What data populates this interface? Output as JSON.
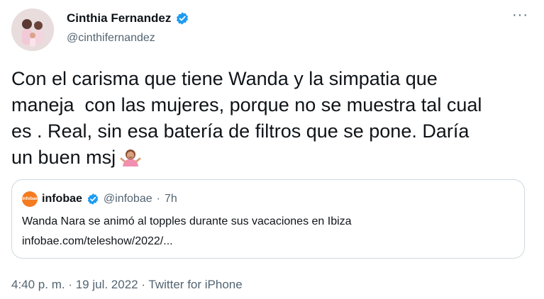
{
  "author": {
    "name": "Cinthia Fernandez",
    "handle": "@cinthifernandez"
  },
  "menu": {
    "more_label": "···"
  },
  "tweet": {
    "text": "Con el carisma que tiene Wanda y la simpatia que\nmaneja  con las mujeres, porque no se muestra tal cual\nes . Real, sin esa batería de filtros que se pone. Daría\nun buen msj"
  },
  "quote": {
    "logo_text": "infobae",
    "name": "infobae",
    "handle": "@infobae",
    "separator": "·",
    "time": "7h",
    "text": "Wanda Nara se animó al topples durante sus vacaciones en Ibiza",
    "link": "infobae.com/teleshow/2022/..."
  },
  "meta": {
    "timestamp": "4:40 p. m. · 19 jul. 2022 · Twitter for iPhone"
  },
  "colors": {
    "verified": "#1d9bf0",
    "infobae_orange": "#f47b20",
    "secondary_text": "#536471"
  }
}
